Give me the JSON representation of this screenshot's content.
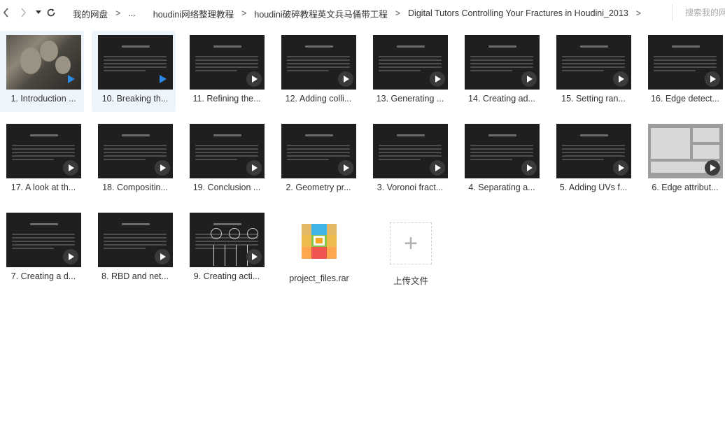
{
  "toolbar": {
    "back_icon": "chevron-left-icon",
    "forward_icon": "chevron-right-icon",
    "dropdown_icon": "caret-down-icon",
    "refresh_icon": "refresh-icon",
    "breadcrumbs": [
      "我的网盘",
      "...",
      "houdini网络整理教程",
      "houdini破碎教程英文兵马俑带工程",
      "Digital Tutors Controlling Your Fractures in Houdini_2013"
    ],
    "separator": ">",
    "search_placeholder": "搜索我的网"
  },
  "files": [
    {
      "label": "1. Introduction ...",
      "thumb": "photo",
      "selected": true
    },
    {
      "label": "10. Breaking th...",
      "thumb": "slide",
      "selected": true
    },
    {
      "label": "11. Refining the...",
      "thumb": "slide"
    },
    {
      "label": "12. Adding colli...",
      "thumb": "slide"
    },
    {
      "label": "13. Generating ...",
      "thumb": "slide"
    },
    {
      "label": "14. Creating ad...",
      "thumb": "slide"
    },
    {
      "label": "15. Setting ran...",
      "thumb": "slide"
    },
    {
      "label": "16. Edge detect...",
      "thumb": "slide"
    },
    {
      "label": "17. A look at th...",
      "thumb": "slide"
    },
    {
      "label": "18. Compositin...",
      "thumb": "slide"
    },
    {
      "label": "19. Conclusion ...",
      "thumb": "slide"
    },
    {
      "label": "2. Geometry pr...",
      "thumb": "slide"
    },
    {
      "label": "3. Voronoi fract...",
      "thumb": "slide"
    },
    {
      "label": "4. Separating a...",
      "thumb": "slide"
    },
    {
      "label": "5. Adding UVs f...",
      "thumb": "slide"
    },
    {
      "label": "6. Edge attribut...",
      "thumb": "screen"
    },
    {
      "label": "7. Creating a d...",
      "thumb": "slide"
    },
    {
      "label": "8. RBD and net...",
      "thumb": "slide"
    },
    {
      "label": "9. Creating acti...",
      "thumb": "diagram"
    }
  ],
  "archive": {
    "label": "project_files.rar",
    "icon": "rar-archive-icon"
  },
  "upload": {
    "label": "上传文件",
    "icon": "plus-icon"
  },
  "colors": {
    "accent": "#2b8ae6",
    "thumb_bg": "#1f1f1f",
    "selected_bg": "#eef4fb"
  }
}
